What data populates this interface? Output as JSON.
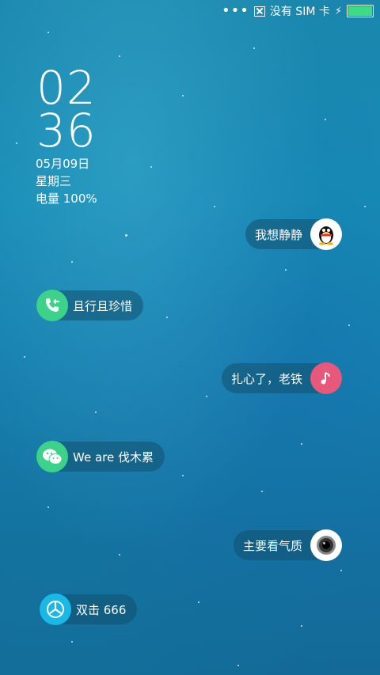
{
  "status_bar": {
    "sim_text": "没有 SIM 卡",
    "battery_level": 1.0
  },
  "clock": {
    "hour": "02",
    "minute": "36"
  },
  "date": "05月09日",
  "weekday": "星期三",
  "battery_text": "电量 100%",
  "notifications": [
    {
      "text": "我想静静",
      "icon": "qq-penguin-icon",
      "color": "#ffffff",
      "side": "right"
    },
    {
      "text": "且行且珍惜",
      "icon": "phone-call-icon",
      "color": "#3dd28a",
      "side": "left"
    },
    {
      "text": "扎心了，老铁",
      "icon": "music-note-icon",
      "color": "#e8587a",
      "side": "right"
    },
    {
      "text": "We are 伐木累",
      "icon": "wechat-icon",
      "color": "#3dd28a",
      "side": "left"
    },
    {
      "text": "主要看气质",
      "icon": "camera-lens-icon",
      "color": "#ffffff",
      "side": "right"
    },
    {
      "text": "双击 666",
      "icon": "pinwheel-icon",
      "color": "#19b8e6",
      "side": "left"
    }
  ]
}
